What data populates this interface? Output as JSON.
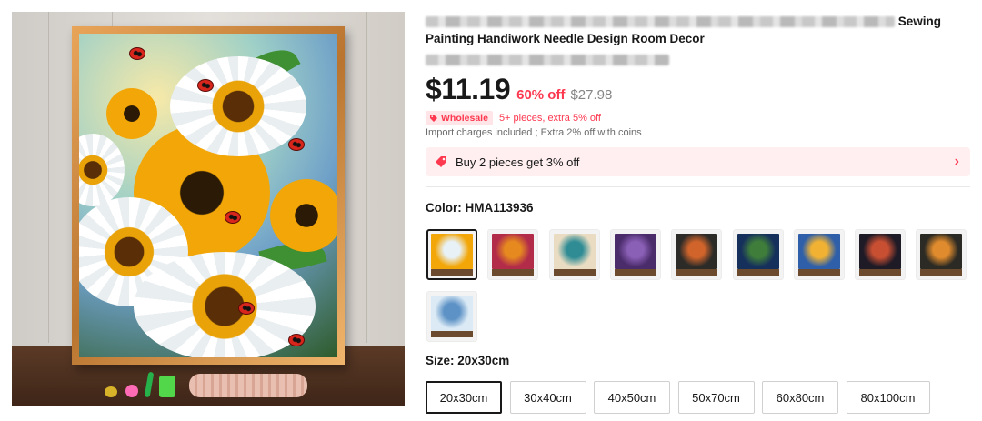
{
  "product": {
    "title_visible_line1_end": "Sewing",
    "title_line2": "Painting Handiwork Needle Design Room Decor"
  },
  "price": {
    "current": "$11.19",
    "discount": "60% off",
    "original": "$27.98"
  },
  "wholesale": {
    "tag_label": "Wholesale",
    "text": "5+ pieces, extra 5% off"
  },
  "import_note": "Import charges included ; Extra 2% off with coins",
  "promo": {
    "text": "Buy 2 pieces get 3% off",
    "icon": "price-tag-icon",
    "chevron": "›"
  },
  "color": {
    "label": "Color: HMA113936",
    "swatches": [
      {
        "icon": "sunflower-ladybug-thumb",
        "colors": [
          "#f2a607",
          "#e8f1f5"
        ],
        "selected": true
      },
      {
        "icon": "flower-bouquet-thumb",
        "colors": [
          "#b22c4a",
          "#e68a1f"
        ],
        "selected": false
      },
      {
        "icon": "mandala-cream-thumb",
        "colors": [
          "#e9dcc2",
          "#2f8c95"
        ],
        "selected": false
      },
      {
        "icon": "purple-floral-thumb",
        "colors": [
          "#4b2c6b",
          "#8a5fb6"
        ],
        "selected": false
      },
      {
        "icon": "dark-mandala-thumb",
        "colors": [
          "#2c2b28",
          "#d0642b"
        ],
        "selected": false
      },
      {
        "icon": "blue-iris-thumb",
        "colors": [
          "#16305c",
          "#3f7e3a"
        ],
        "selected": false
      },
      {
        "icon": "bee-sky-thumb",
        "colors": [
          "#2e5fa8",
          "#f1b234"
        ],
        "selected": false
      },
      {
        "icon": "night-floral-thumb",
        "colors": [
          "#1e1a26",
          "#c94f33"
        ],
        "selected": false
      },
      {
        "icon": "folk-floral-thumb",
        "colors": [
          "#2b2a24",
          "#e08b2d"
        ],
        "selected": false
      },
      {
        "icon": "white-hibiscus-thumb",
        "colors": [
          "#dbeaf5",
          "#5d92c6"
        ],
        "selected": false
      }
    ]
  },
  "size": {
    "label": "Size: 20x30cm",
    "options": [
      {
        "label": "20x30cm",
        "selected": true
      },
      {
        "label": "30x40cm",
        "selected": false
      },
      {
        "label": "40x50cm",
        "selected": false
      },
      {
        "label": "50x70cm",
        "selected": false
      },
      {
        "label": "60x80cm",
        "selected": false
      },
      {
        "label": "80x100cm",
        "selected": false
      }
    ]
  },
  "colors": {
    "accent": "#fd384f",
    "promo_bg": "#ffeff1",
    "text": "#191919"
  }
}
